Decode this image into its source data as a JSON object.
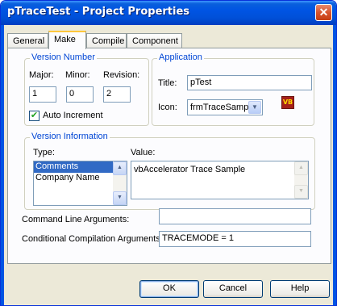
{
  "window": {
    "title": "pTraceTest - Project Properties",
    "close_glyph": "✕"
  },
  "tabs": [
    {
      "label": "General",
      "active": false
    },
    {
      "label": "Make",
      "active": true
    },
    {
      "label": "Compile",
      "active": false
    },
    {
      "label": "Component",
      "active": false
    }
  ],
  "version_number": {
    "legend": "Version Number",
    "major_label": "Major:",
    "minor_label": "Minor:",
    "revision_label": "Revision:",
    "major": "1",
    "minor": "0",
    "revision": "2",
    "auto_increment_label": "Auto Increment",
    "auto_increment_checked": true
  },
  "application": {
    "legend": "Application",
    "title_label": "Title:",
    "title_value": "pTest",
    "icon_label": "Icon:",
    "icon_value": "frmTraceSample",
    "icon_preview": "vb-project-icon"
  },
  "version_info": {
    "legend": "Version Information",
    "type_label": "Type:",
    "value_label": "Value:",
    "types": [
      "Comments",
      "Company Name"
    ],
    "selected_type": "Comments",
    "value": "vbAccelerator Trace Sample"
  },
  "command_line": {
    "label": "Command Line Arguments:",
    "value": ""
  },
  "conditional_compilation": {
    "label": "Conditional Compilation Arguments:",
    "value": "TRACEMODE = 1"
  },
  "buttons": {
    "ok": "OK",
    "cancel": "Cancel",
    "help": "Help"
  },
  "colors": {
    "titlebar": "#0054e3",
    "groupbox_legend": "#0046d5",
    "selection": "#316ac5",
    "dialog_face": "#ece9d8"
  }
}
